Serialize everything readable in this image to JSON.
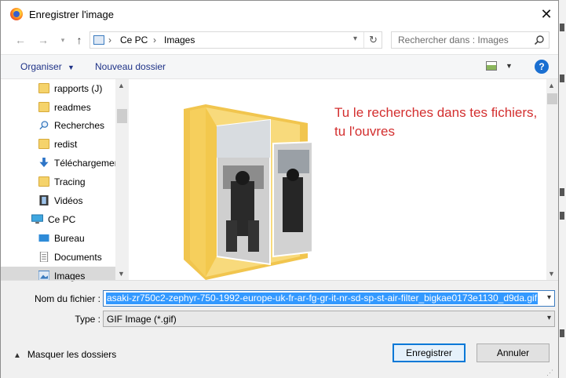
{
  "window": {
    "title": "Enregistrer l'image"
  },
  "address": {
    "root": "Ce PC",
    "folder": "Images"
  },
  "search": {
    "placeholder": "Rechercher dans : Images"
  },
  "toolbar": {
    "organise": "Organiser",
    "new_folder": "Nouveau dossier"
  },
  "sidebar": {
    "items": [
      {
        "label": "rapports (J)",
        "icon": "folder-icon"
      },
      {
        "label": "readmes",
        "icon": "folder-icon"
      },
      {
        "label": "Recherches",
        "icon": "search-icon"
      },
      {
        "label": "redist",
        "icon": "folder-icon"
      },
      {
        "label": "Téléchargemer",
        "icon": "download-icon"
      },
      {
        "label": "Tracing",
        "icon": "folder-icon"
      },
      {
        "label": "Vidéos",
        "icon": "video-icon"
      },
      {
        "label": "Ce PC",
        "icon": "computer-icon"
      },
      {
        "label": "Bureau",
        "icon": "desktop-icon"
      },
      {
        "label": "Documents",
        "icon": "documents-icon"
      },
      {
        "label": "Images",
        "icon": "images-icon"
      }
    ]
  },
  "preview": {
    "annotation": "Tu le recherches dans tes fichiers, tu l'ouvres"
  },
  "form": {
    "filename_label": "Nom du fichier :",
    "filename_value": "asaki-zr750c2-zephyr-750-1992-europe-uk-fr-ar-fg-gr-it-nr-sd-sp-st-air-filter_bigkae0173e1130_d9da.gif",
    "type_label": "Type :",
    "type_value": "GIF Image (*.gif)"
  },
  "footer": {
    "hide_folders": "Masquer les dossiers",
    "save": "Enregistrer",
    "cancel": "Annuler"
  },
  "colors": {
    "accent": "#0078d7",
    "annotation": "#d32f2f",
    "selection": "#3399ff",
    "folder": "#f5d36b"
  }
}
